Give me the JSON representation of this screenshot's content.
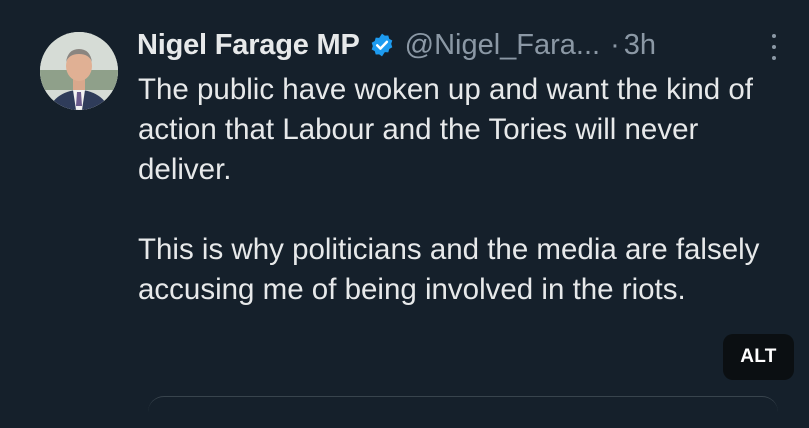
{
  "tweet": {
    "display_name": "Nigel Farage MP",
    "verified_icon": "verified-badge-icon",
    "handle": "@Nigel_Fara...",
    "separator": "·",
    "time": "3h",
    "more_icon": "more-options-icon",
    "paragraphs": [
      "The public have woken up and want the kind of action that Labour and the Tories will never deliver.",
      "This is why politicians and the media are falsely accusing me of being involved in the riots."
    ],
    "alt_label": "ALT"
  },
  "colors": {
    "background": "#15202b",
    "text_primary": "#e7e9ea",
    "text_secondary": "#8b98a5",
    "verified_blue": "#1d9bf0",
    "alt_badge_bg": "#0b0f12"
  }
}
